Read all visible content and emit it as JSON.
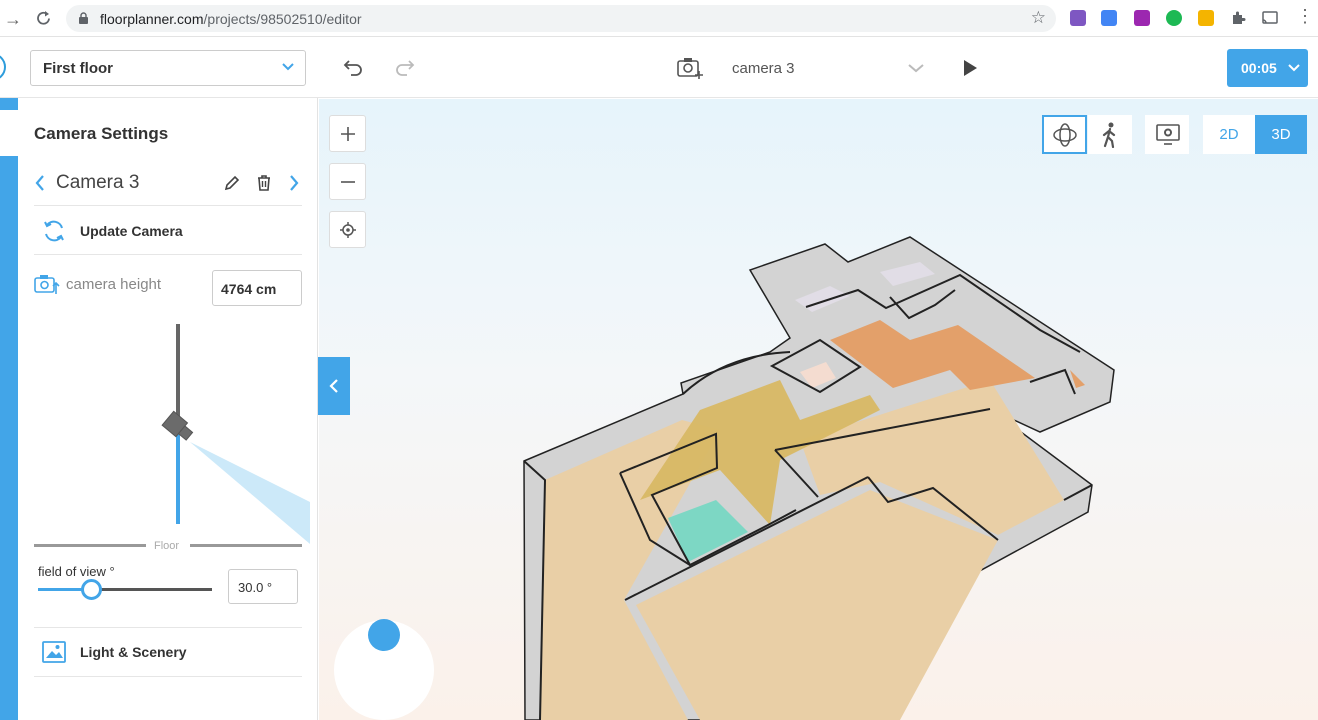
{
  "browser": {
    "url_host": "floorplanner.com",
    "url_path": "/projects/98502510/editor"
  },
  "toolbar": {
    "floor_select": "First floor",
    "camera_select": "camera 3",
    "timer": "00:05"
  },
  "panel": {
    "title": "Camera Settings",
    "camera_name": "Camera 3",
    "update_camera": "Update Camera",
    "camera_height_label": "camera height",
    "camera_height_value": "4764 cm",
    "floor_label": "Floor",
    "fov_label": "field of view °",
    "fov_value": "30.0 °",
    "fov_fraction": 0.3,
    "light_scenery": "Light & Scenery"
  },
  "view": {
    "mode_2d": "2D",
    "mode_3d": "3D",
    "active_mode": "3D"
  },
  "colors": {
    "accent": "#42a5e8",
    "floor_beige": "#e9cfa6",
    "floor_gold": "#d8b864",
    "floor_orange": "#e3a06a",
    "floor_teal": "#7dd7c4"
  }
}
